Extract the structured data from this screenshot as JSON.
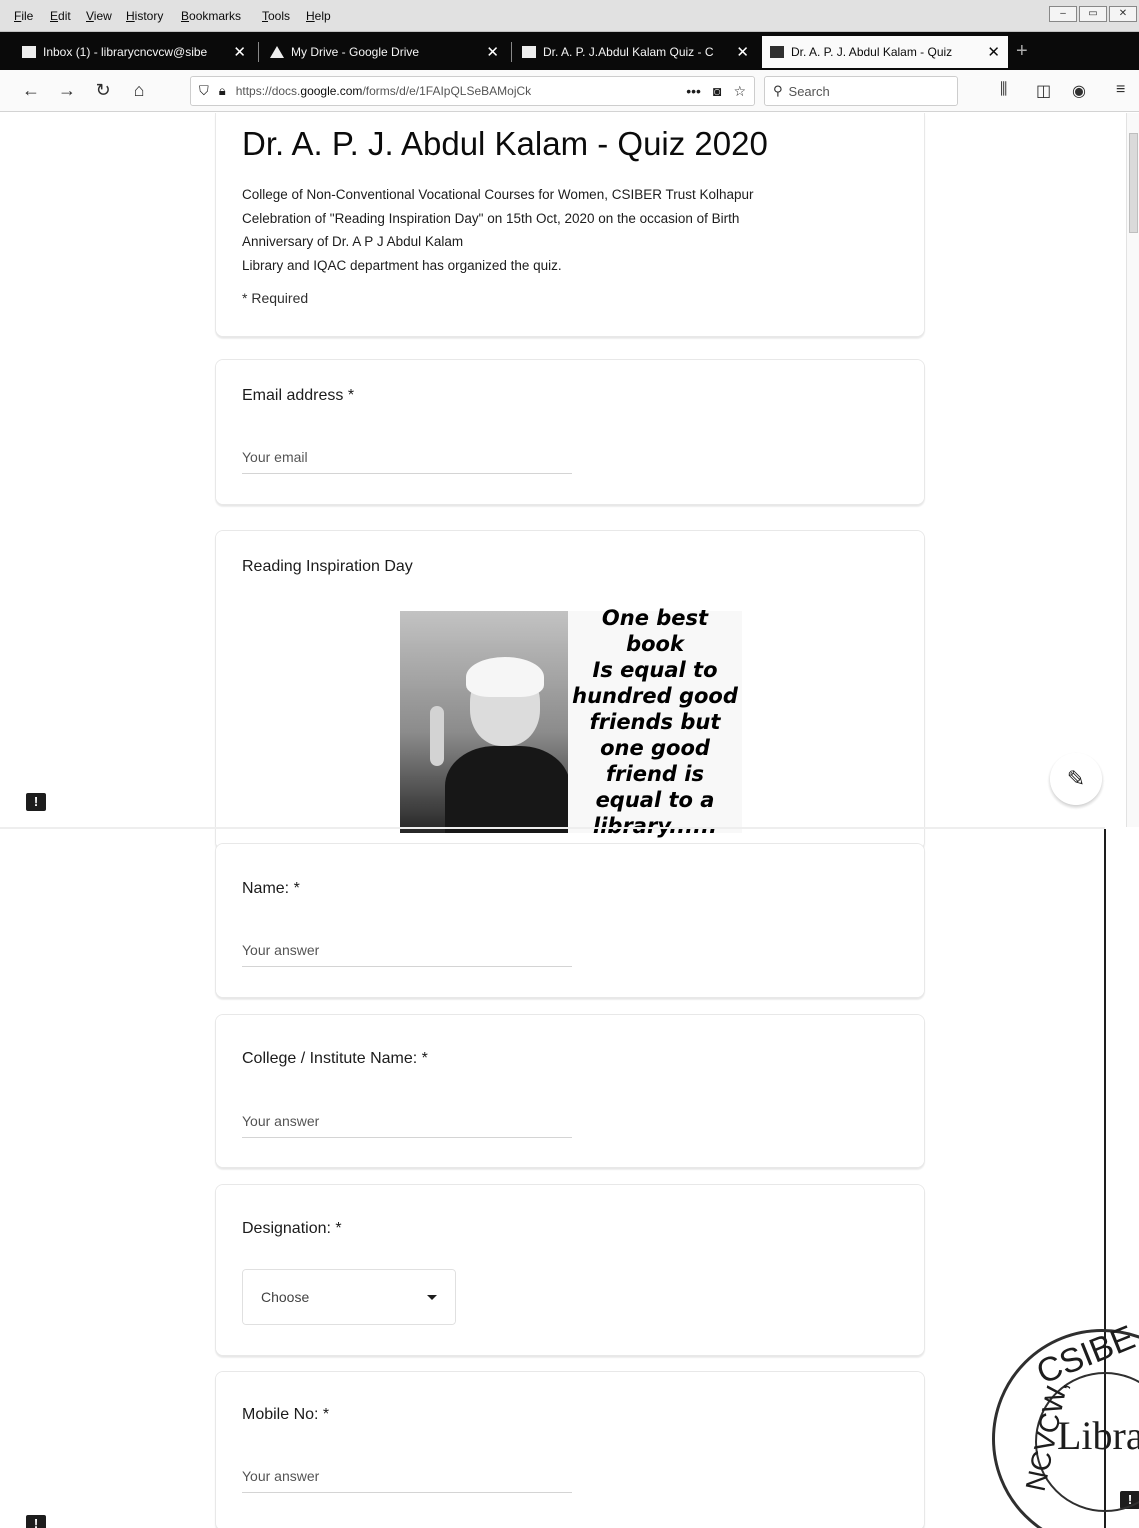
{
  "menubar": {
    "items": [
      "File",
      "Edit",
      "View",
      "History",
      "Bookmarks",
      "Tools",
      "Help"
    ]
  },
  "tabs": [
    {
      "title": "Inbox (1) - librarycncvcw@sibe",
      "icon": "mail-icon",
      "active": false
    },
    {
      "title": "My Drive - Google Drive",
      "icon": "drive-icon",
      "active": false
    },
    {
      "title": "Dr. A. P. J.Abdul Kalam Quiz - C",
      "icon": "forms-icon",
      "active": false
    },
    {
      "title": "Dr. A. P. J. Abdul Kalam - Quiz",
      "icon": "forms-icon",
      "active": true
    }
  ],
  "nav": {
    "url_prefix": "https://docs.",
    "url_domain": "google.com",
    "url_path": "/forms/d/e/1FAIpQLSeBAMojCk",
    "search_placeholder": "Search"
  },
  "form": {
    "title": "Dr. A. P. J. Abdul Kalam - Quiz 2020",
    "description": [
      "College of Non-Conventional Vocational Courses for Women, CSIBER Trust Kolhapur",
      "Celebration of \"Reading Inspiration Day\" on 15th Oct, 2020 on the occasion of Birth",
      "Anniversary of Dr. A P J Abdul Kalam",
      "Library and IQAC department has organized the quiz."
    ],
    "required_note": "* Required",
    "email": {
      "label": "Email address *",
      "placeholder": "Your email"
    },
    "section": {
      "label": "Reading Inspiration Day",
      "quote": [
        "One best book",
        "Is equal to",
        "hundred good",
        "friends but",
        "one good",
        "friend is",
        "equal to a",
        "library......"
      ]
    },
    "name": {
      "label": "Name: *",
      "placeholder": "Your answer"
    },
    "college": {
      "label": "College / Institute Name: *",
      "placeholder": "Your answer"
    },
    "designation": {
      "label": "Designation: *",
      "selected": "Choose"
    },
    "mobile": {
      "label": "Mobile No: *",
      "placeholder": "Your answer"
    }
  },
  "stamp": {
    "top_text": "CSIBE",
    "side_text": "NCVCW,",
    "center_text": "Libra"
  }
}
